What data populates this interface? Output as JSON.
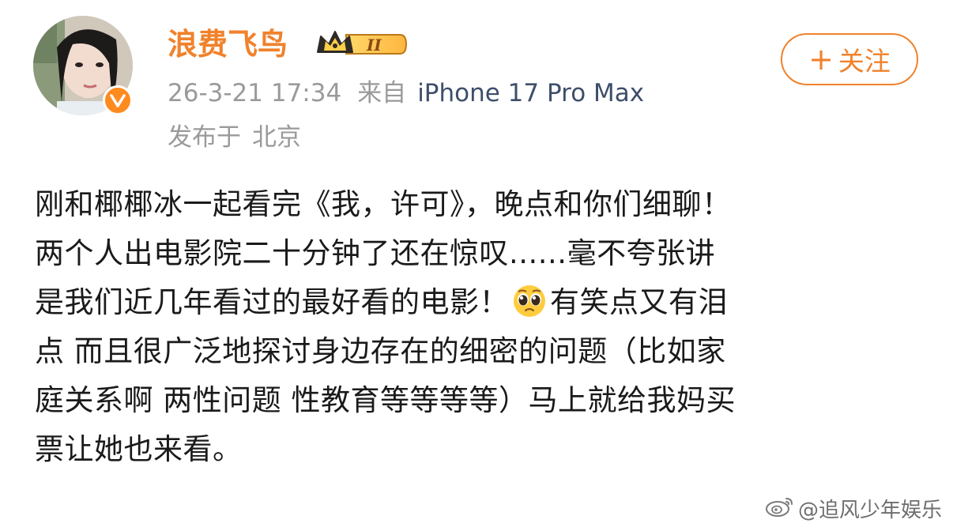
{
  "post": {
    "author": {
      "name": "浪费飞鸟",
      "avatar_icon": "user-avatar-photo",
      "verified_icon": "verified-v-icon",
      "vip_level": "II"
    },
    "timestamp": "26-3-21 17:34",
    "source_prefix": "来自",
    "device": "iPhone 17 Pro Max",
    "location_prefix": "发布于",
    "location": "北京",
    "follow_label": "关注",
    "body": {
      "line1": "刚和椰椰冰一起看完《我，许可》，晚点和你们细聊！",
      "line2": "两个人出电影院二十分钟了还在惊叹......毫不夸张讲",
      "line3a": "是我们近几年看过的最好看的电影！",
      "line3_emoji": "pleading-face-emoji",
      "line3b": "有笑点又有泪",
      "line4": "点 而且很广泛地探讨身边存在的细密的问题（比如家",
      "line5": "庭关系啊 两性问题 性教育等等等等）马上就给我妈买",
      "line6": "票让她也来看。"
    }
  },
  "watermark": {
    "text": "@追风少年娱乐",
    "icon": "weibo-logo-icon"
  },
  "colors": {
    "accent": "#f0822c",
    "meta": "#9a9a9a",
    "device": "#3e4e6a",
    "text": "#1a1a1a"
  }
}
